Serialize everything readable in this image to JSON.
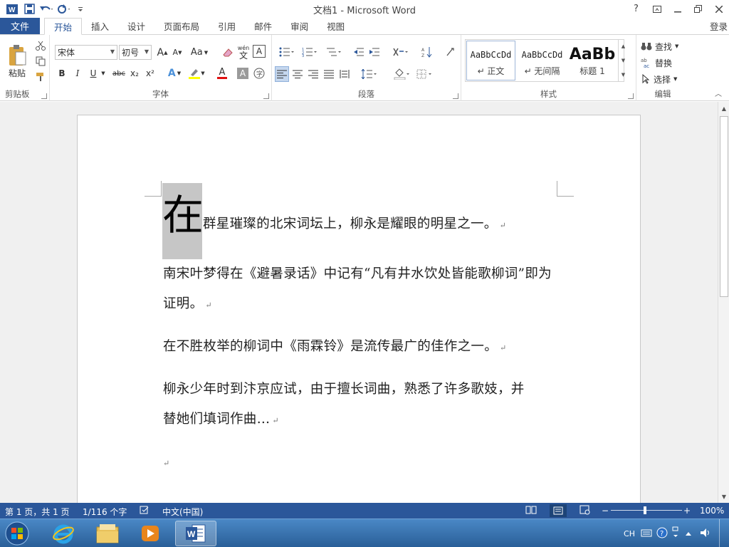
{
  "app": {
    "title": "文档1 - Microsoft Word",
    "help": "?",
    "login": "登录",
    "colors": {
      "accent": "#2b579a",
      "ribbon_border": "#d4d4d4",
      "doc_bg": "#f0f0f0",
      "dropcap_bg": "#c6c6c6"
    }
  },
  "qat": {
    "icons": [
      "word-logo-icon",
      "save-icon",
      "undo-icon",
      "redo-icon",
      "customize-icon"
    ]
  },
  "tabs": {
    "file": "文件",
    "items": [
      "开始",
      "插入",
      "设计",
      "页面布局",
      "引用",
      "邮件",
      "审阅",
      "视图"
    ],
    "active": "开始"
  },
  "ribbon": {
    "clipboard": {
      "label": "剪贴板",
      "paste": "粘贴"
    },
    "font": {
      "label": "字体",
      "font_name": "宋体",
      "font_size": "初号",
      "grow": "A",
      "shrink": "A",
      "case": "Aa",
      "phonetic": "wén",
      "phonetic_char": "文",
      "bold": "B",
      "italic": "I",
      "underline": "U",
      "strike": "abc",
      "subscript": "x₂",
      "superscript": "x²",
      "color_a": "A"
    },
    "paragraph": {
      "label": "段落"
    },
    "styles": {
      "label": "样式",
      "items": [
        {
          "preview": "AaBbCcDd",
          "name": "↵ 正文"
        },
        {
          "preview": "AaBbCcDd",
          "name": "↵ 无间隔"
        },
        {
          "preview": "AaBb",
          "name": "标题 1"
        }
      ]
    },
    "editing": {
      "label": "编辑",
      "find": "查找",
      "replace": "替换",
      "select": "选择"
    }
  },
  "document": {
    "dropcap": "在",
    "paragraphs": [
      "群星璀璨的北宋词坛上，柳永是耀眼的明星之一。",
      "南宋叶梦得在《避暑录话》中记有“凡有井水饮处皆能歌柳词”即为证明。",
      "在不胜枚举的柳词中《雨霖铃》是流传最广的佳作之一。",
      "柳永少年时到汴京应试，由于擅长词曲，熟悉了许多歌妓，并替她们填词作曲…"
    ],
    "para_mark": "↵"
  },
  "status": {
    "page": "第 1 页，共 1 页",
    "words": "1/116 个字",
    "lang": "中文(中国)",
    "zoom": "100%",
    "zoom_minus": "−",
    "zoom_plus": "+"
  },
  "taskbar": {
    "items": [
      "start-orb-icon",
      "internet-explorer-icon",
      "file-explorer-icon",
      "media-player-icon",
      "word-icon"
    ],
    "tray_lang": "CH"
  }
}
